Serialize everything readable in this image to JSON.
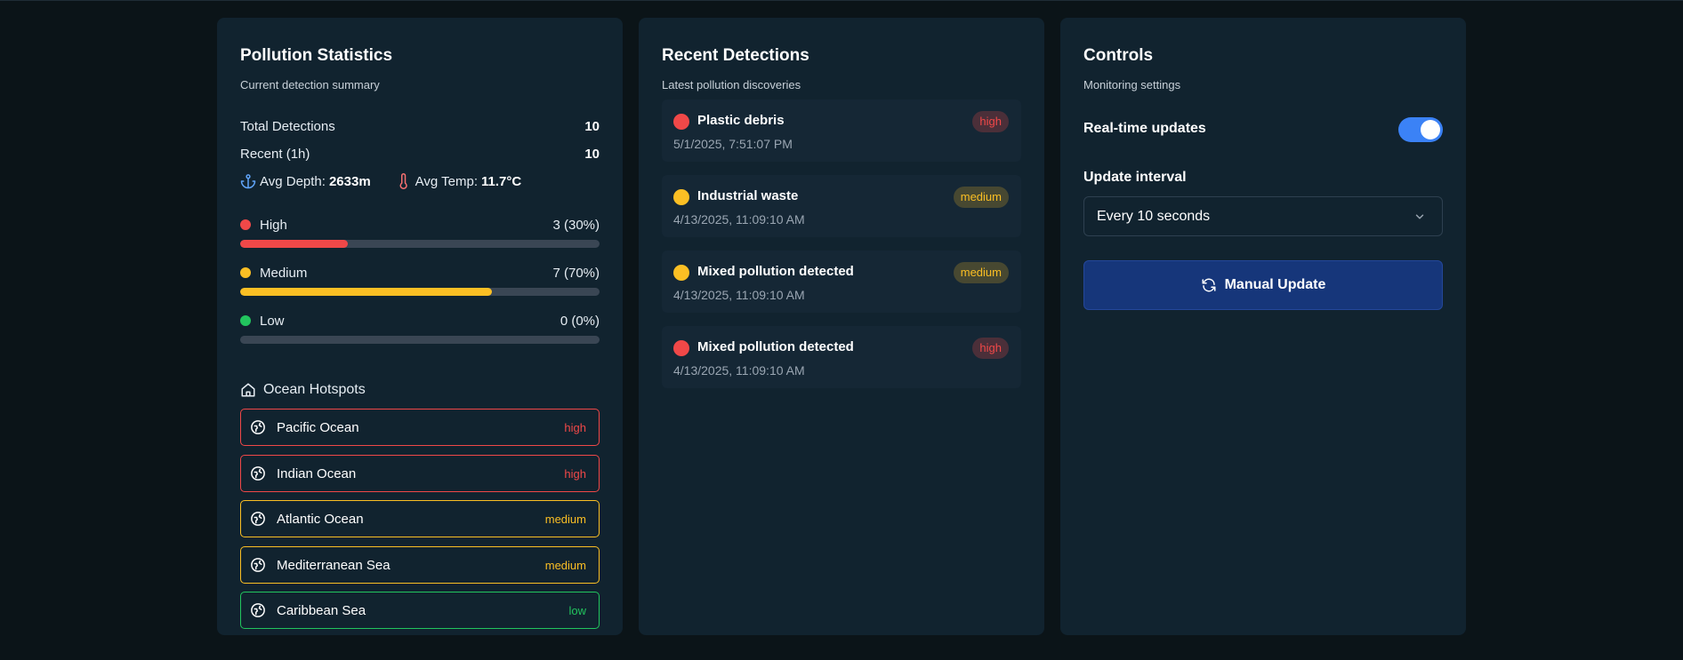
{
  "stats": {
    "title": "Pollution Statistics",
    "subtitle": "Current detection summary",
    "total_label": "Total Detections",
    "total_value": "10",
    "recent_label": "Recent (1h)",
    "recent_value": "10",
    "avg_depth_label": "Avg Depth:",
    "avg_depth_value": "2633m",
    "avg_temp_label": "Avg Temp:",
    "avg_temp_value": "11.7°C",
    "severity": [
      {
        "label": "High",
        "count": "3 (30%)",
        "fraction": 0.3,
        "color": "#f04848"
      },
      {
        "label": "Medium",
        "count": "7 (70%)",
        "fraction": 0.7,
        "color": "#fbbf24"
      },
      {
        "label": "Low",
        "count": "0 (0%)",
        "fraction": 0.0,
        "color": "#22c55e"
      }
    ]
  },
  "hotspots": {
    "title": "Ocean Hotspots",
    "items": [
      {
        "name": "Pacific Ocean",
        "severity": "high"
      },
      {
        "name": "Indian Ocean",
        "severity": "high"
      },
      {
        "name": "Atlantic Ocean",
        "severity": "medium"
      },
      {
        "name": "Mediterranean Sea",
        "severity": "medium"
      },
      {
        "name": "Caribbean Sea",
        "severity": "low"
      }
    ]
  },
  "detections": {
    "title": "Recent Detections",
    "subtitle": "Latest pollution discoveries",
    "items": [
      {
        "name": "Plastic debris",
        "time": "5/1/2025, 7:51:07 PM",
        "severity": "high"
      },
      {
        "name": "Industrial waste",
        "time": "4/13/2025, 11:09:10 AM",
        "severity": "medium"
      },
      {
        "name": "Mixed pollution detected",
        "time": "4/13/2025, 11:09:10 AM",
        "severity": "medium"
      },
      {
        "name": "Mixed pollution detected",
        "time": "4/13/2025, 11:09:10 AM",
        "severity": "high"
      }
    ]
  },
  "controls": {
    "title": "Controls",
    "subtitle": "Monitoring settings",
    "realtime_label": "Real-time updates",
    "realtime_on": true,
    "interval_label": "Update interval",
    "interval_value": "Every 10 seconds",
    "manual_update_label": "Manual Update"
  },
  "colors": {
    "high": "#f04848",
    "medium": "#fbbf24",
    "low": "#22c55e",
    "accent": "#3b82f6",
    "button": "#16367a"
  }
}
